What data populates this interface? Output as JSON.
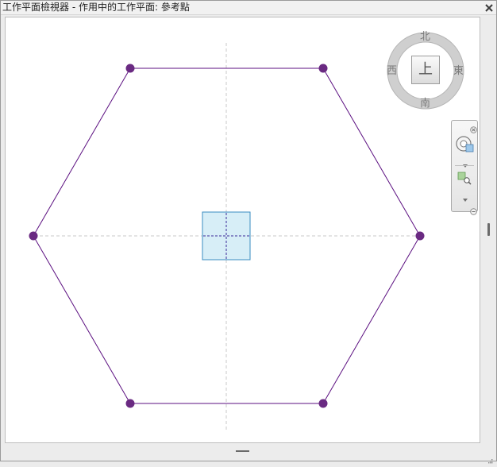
{
  "window": {
    "title": "工作平面檢視器 - 作用中的工作平面: 參考點"
  },
  "viewcube": {
    "north": "北",
    "south": "南",
    "east": "東",
    "west": "西",
    "face": "上"
  },
  "colors": {
    "hexagon_line": "#5b0f80",
    "vertex": "#6a2a82",
    "center_fill": "#d7eef7",
    "center_border": "#3a8cc0",
    "center_crosshair": "#3b2a9a",
    "guide": "#c8c8c8"
  },
  "icons": {
    "close": "close-icon",
    "navbar_close": "close-circle-icon",
    "steering_wheel": "steering-wheel-icon",
    "zoom_region": "zoom-region-icon",
    "dropdown": "chevron-down-icon",
    "navbar_collapse": "collapse-icon",
    "resize_grip": "resize-grip-icon"
  }
}
